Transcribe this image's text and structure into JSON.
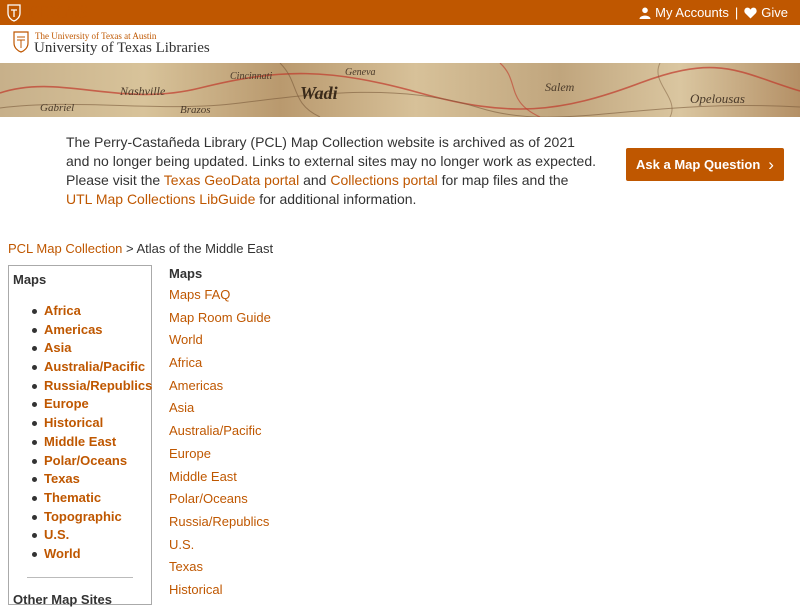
{
  "topbar": {
    "brand": "TEXAS",
    "my_accounts": "My Accounts",
    "separator": "|",
    "give": "Give"
  },
  "library_header": {
    "subtitle": "The University of Texas at Austin",
    "title": "University of Texas Libraries"
  },
  "banner": {
    "map_labels": [
      "Nashville",
      "Cincinnati",
      "Geneva",
      "Wadi",
      "Salem",
      "Opelousas",
      "Gabriel",
      "Brazos"
    ]
  },
  "notice": {
    "text_1": "The Perry-Castañeda Library (PCL) Map Collection website is archived as of 2021 and no longer being updated. Links to external sites may no longer work as expected. Please visit the ",
    "link_1": "Texas GeoData portal",
    "text_2": " and ",
    "link_2": "Collections portal",
    "text_3": " for map files and the ",
    "link_3": "UTL Map Collections LibGuide",
    "text_4": " for additional information."
  },
  "ask_button": {
    "label": "Ask a Map Question",
    "chevron": "›"
  },
  "breadcrumb": {
    "link": "PCL Map Collection",
    "separator": " > ",
    "current": "Atlas of the Middle East"
  },
  "sidebar": {
    "heading": "Maps",
    "items": [
      "Africa",
      "Americas",
      "Asia",
      "Australia/Pacific",
      "Russia/Republics",
      "Europe",
      "Historical",
      "Middle East",
      "Polar/Oceans",
      "Texas",
      "Thematic",
      "Topographic",
      "U.S.",
      "World"
    ],
    "other_heading": "Other Map Sites"
  },
  "main": {
    "heading": "Maps",
    "links": [
      "Maps FAQ",
      "Map Room Guide",
      "World",
      "Africa",
      "Americas",
      "Asia",
      "Australia/Pacific",
      "Europe",
      "Middle East",
      "Polar/Oceans",
      "Russia/Republics",
      "U.S.",
      "Texas",
      "Historical"
    ]
  },
  "colors": {
    "accent": "#bf5700",
    "text": "#333333"
  }
}
